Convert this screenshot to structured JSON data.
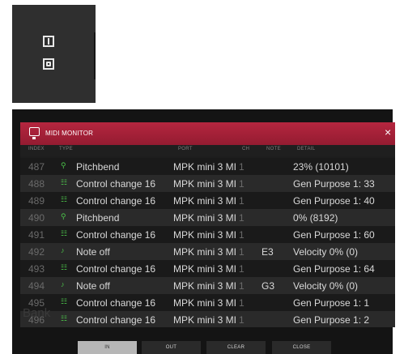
{
  "io_panel": {
    "in_icon": "input-port-icon",
    "out_icon": "output-port-icon"
  },
  "monitor": {
    "title": "MIDI MONITOR",
    "close_glyph": "×",
    "columns": {
      "index": "INDEX",
      "type": "TYPE",
      "port": "PORT",
      "ch": "CH",
      "note": "NOTE",
      "detail": "DETAIL"
    },
    "rows": [
      {
        "index": "487",
        "icon": "⚲",
        "icon_name": "pitchbend-icon",
        "type": "Pitchbend",
        "port": "MPK mini 3 MI",
        "ch": "1",
        "note": "",
        "detail": "23% (10101)"
      },
      {
        "index": "488",
        "icon": "☷",
        "icon_name": "control-change-icon",
        "type": "Control change 16",
        "port": "MPK mini 3 MI",
        "ch": "1",
        "note": "",
        "detail": "Gen Purpose 1: 33"
      },
      {
        "index": "489",
        "icon": "☷",
        "icon_name": "control-change-icon",
        "type": "Control change 16",
        "port": "MPK mini 3 MI",
        "ch": "1",
        "note": "",
        "detail": "Gen Purpose 1: 40"
      },
      {
        "index": "490",
        "icon": "⚲",
        "icon_name": "pitchbend-icon",
        "type": "Pitchbend",
        "port": "MPK mini 3 MI",
        "ch": "1",
        "note": "",
        "detail": "0% (8192)"
      },
      {
        "index": "491",
        "icon": "☷",
        "icon_name": "control-change-icon",
        "type": "Control change 16",
        "port": "MPK mini 3 MI",
        "ch": "1",
        "note": "",
        "detail": "Gen Purpose 1: 60"
      },
      {
        "index": "492",
        "icon": "♪",
        "icon_name": "note-off-icon",
        "type": "Note off",
        "port": "MPK mini 3 MI",
        "ch": "1",
        "note": "E3",
        "detail": "Velocity 0% (0)"
      },
      {
        "index": "493",
        "icon": "☷",
        "icon_name": "control-change-icon",
        "type": "Control change 16",
        "port": "MPK mini 3 MI",
        "ch": "1",
        "note": "",
        "detail": "Gen Purpose 1: 64"
      },
      {
        "index": "494",
        "icon": "♪",
        "icon_name": "note-off-icon",
        "type": "Note off",
        "port": "MPK mini 3 MI",
        "ch": "1",
        "note": "G3",
        "detail": "Velocity 0% (0)"
      },
      {
        "index": "495",
        "icon": "☷",
        "icon_name": "control-change-icon",
        "type": "Control change 16",
        "port": "MPK mini 3 MI",
        "ch": "1",
        "note": "",
        "detail": "Gen Purpose 1: 1"
      },
      {
        "index": "496",
        "icon": "☷",
        "icon_name": "control-change-icon",
        "type": "Control change 16",
        "port": "MPK mini 3 MI",
        "ch": "1",
        "note": "",
        "detail": "Gen Purpose 1: 2"
      }
    ],
    "footer": {
      "in": "IN",
      "out": "OUT",
      "clear": "CLEAR",
      "close": "CLOSE"
    },
    "background_text": "Bank"
  },
  "colors": {
    "accent": "#a8203a",
    "icon_green": "#4cc34a",
    "active_button": "#b6b6b6"
  }
}
